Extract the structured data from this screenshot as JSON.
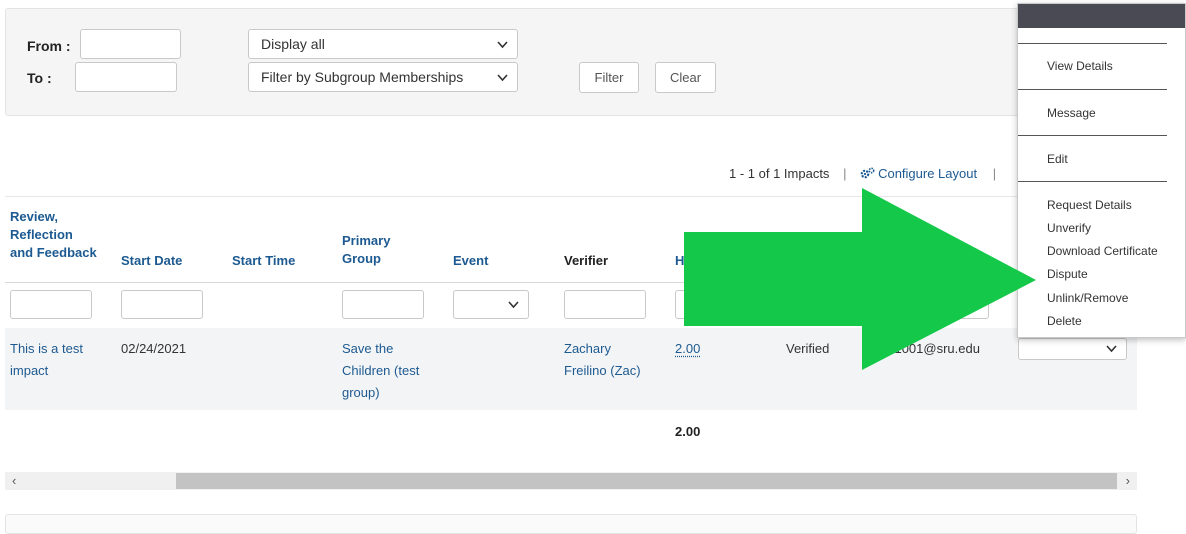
{
  "filters": {
    "from_label": "From :",
    "to_label": "To :",
    "from_value": "",
    "to_value": "",
    "display_select": "Display all",
    "subgroup_select": "Filter by Subgroup Memberships",
    "filter_button": "Filter",
    "clear_button": "Clear"
  },
  "pager": {
    "count_text": "1 - 1 of 1 Impacts",
    "separator": "|",
    "configure_layout": "Configure Layout",
    "separator2": "|"
  },
  "table": {
    "headers": {
      "review_line1": "Review,",
      "review_line2": "Reflection",
      "review_line3": "and Feedback",
      "start_date": "Start Date",
      "start_time": "Start Time",
      "primary_line1": "Primary",
      "primary_line2": "Group",
      "event": "Event",
      "verifier": "Verifier",
      "hours": "He"
    },
    "row": {
      "review_line1": "This is a test",
      "review_line2": "impact",
      "start_date": "02/24/2021",
      "start_time": "",
      "primary_line1": "Save the",
      "primary_line2": "Children (test",
      "primary_line3": "group)",
      "event": "",
      "verifier_line1": "Zachary",
      "verifier_line2": "Freilino (Zac)",
      "hours": "2.00",
      "status": "Verified",
      "email": "en1001@sru.edu"
    },
    "total_hours": "2.00"
  },
  "actions_menu": {
    "items": [
      "View Details",
      "Message",
      "Edit",
      "Request Details",
      "Unverify",
      "Download Certificate",
      "Dispute",
      "Unlink/Remove",
      "Delete"
    ]
  },
  "colors": {
    "link": "#1d5a91",
    "arrow": "#14c94a",
    "menu_header": "#4a4a55"
  }
}
